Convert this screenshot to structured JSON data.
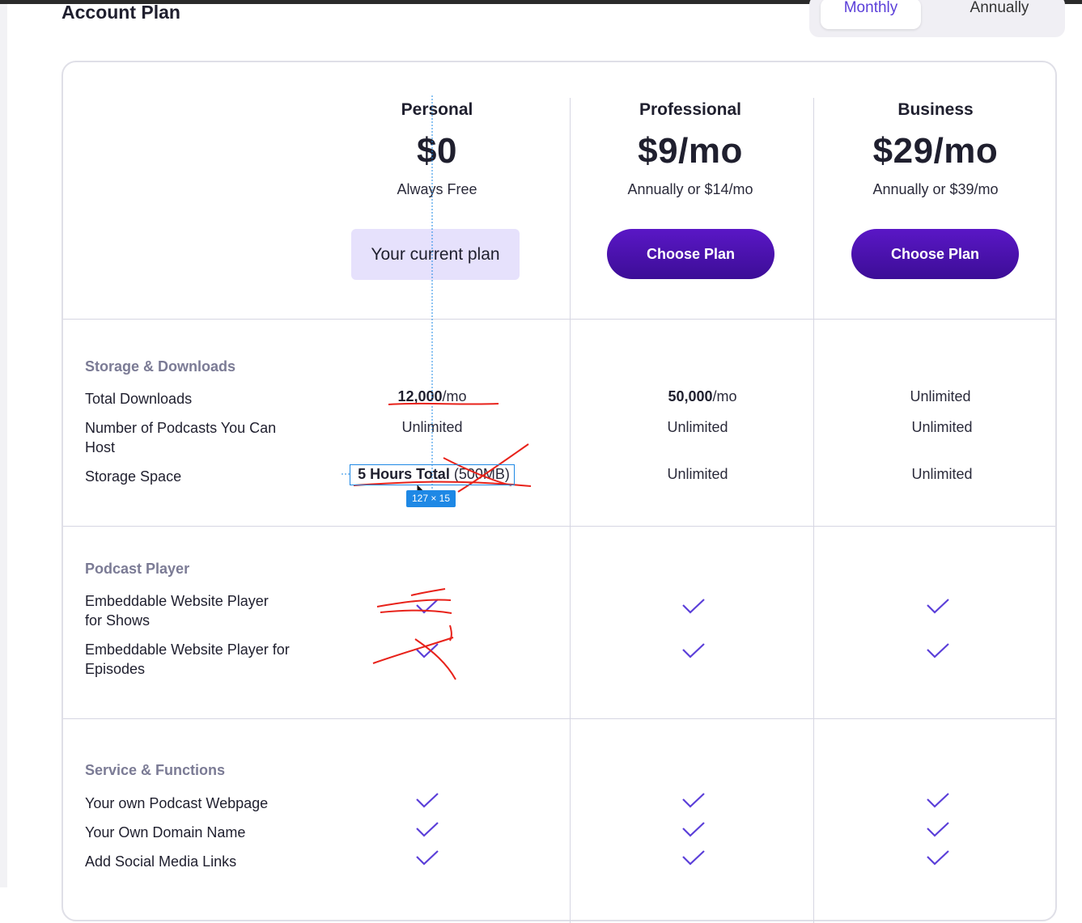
{
  "page": {
    "title": "Account Plan"
  },
  "billing_toggle": {
    "options": [
      "Monthly",
      "Annually"
    ],
    "selected": "Monthly"
  },
  "plans": [
    {
      "name": "Personal",
      "price": "$0",
      "note": "Always Free",
      "action": "Your current plan",
      "current": true
    },
    {
      "name": "Professional",
      "price": "$9/mo",
      "note": "Annually or $14/mo",
      "action": "Choose Plan",
      "current": false
    },
    {
      "name": "Business",
      "price": "$29/mo",
      "note": "Annually or $39/mo",
      "action": "Choose Plan",
      "current": false
    }
  ],
  "sections": {
    "storage": {
      "title": "Storage & Downloads",
      "rows": [
        {
          "label": "Total Downloads",
          "values": [
            {
              "bold": "12,000",
              "rest": "/mo"
            },
            {
              "bold": "50,000",
              "rest": "/mo"
            },
            {
              "bold": "",
              "rest": "Unlimited"
            }
          ]
        },
        {
          "label": "Number of Podcasts You Can Host",
          "values": [
            {
              "bold": "",
              "rest": "Unlimited"
            },
            {
              "bold": "",
              "rest": "Unlimited"
            },
            {
              "bold": "",
              "rest": "Unlimited"
            }
          ]
        },
        {
          "label": "Storage Space",
          "values": [
            {
              "bold": "5 Hours Total",
              "rest": " (500MB)"
            },
            {
              "bold": "",
              "rest": "Unlimited"
            },
            {
              "bold": "",
              "rest": "Unlimited"
            }
          ]
        }
      ]
    },
    "player": {
      "title": "Podcast Player",
      "rows": [
        {
          "label": "Embeddable Website Player for Shows",
          "values": [
            true,
            true,
            true
          ]
        },
        {
          "label": "Embeddable Website Player for Episodes",
          "values": [
            true,
            true,
            true
          ]
        }
      ]
    },
    "service": {
      "title": "Service & Functions",
      "rows": [
        {
          "label": "Your own Podcast Webpage",
          "values": [
            true,
            true,
            true
          ]
        },
        {
          "label": "Your Own Domain Name",
          "values": [
            true,
            true,
            true
          ]
        },
        {
          "label": "Add Social Media Links",
          "values": [
            true,
            true,
            true
          ]
        }
      ]
    }
  },
  "overlay": {
    "measure_badge": "127 × 15"
  },
  "colors": {
    "accent": "#5b3fd9",
    "button": "#4a10b0",
    "current_plan_bg": "#e6e1fc",
    "annotation": "#e8221a",
    "measure": "#1e88e5"
  }
}
